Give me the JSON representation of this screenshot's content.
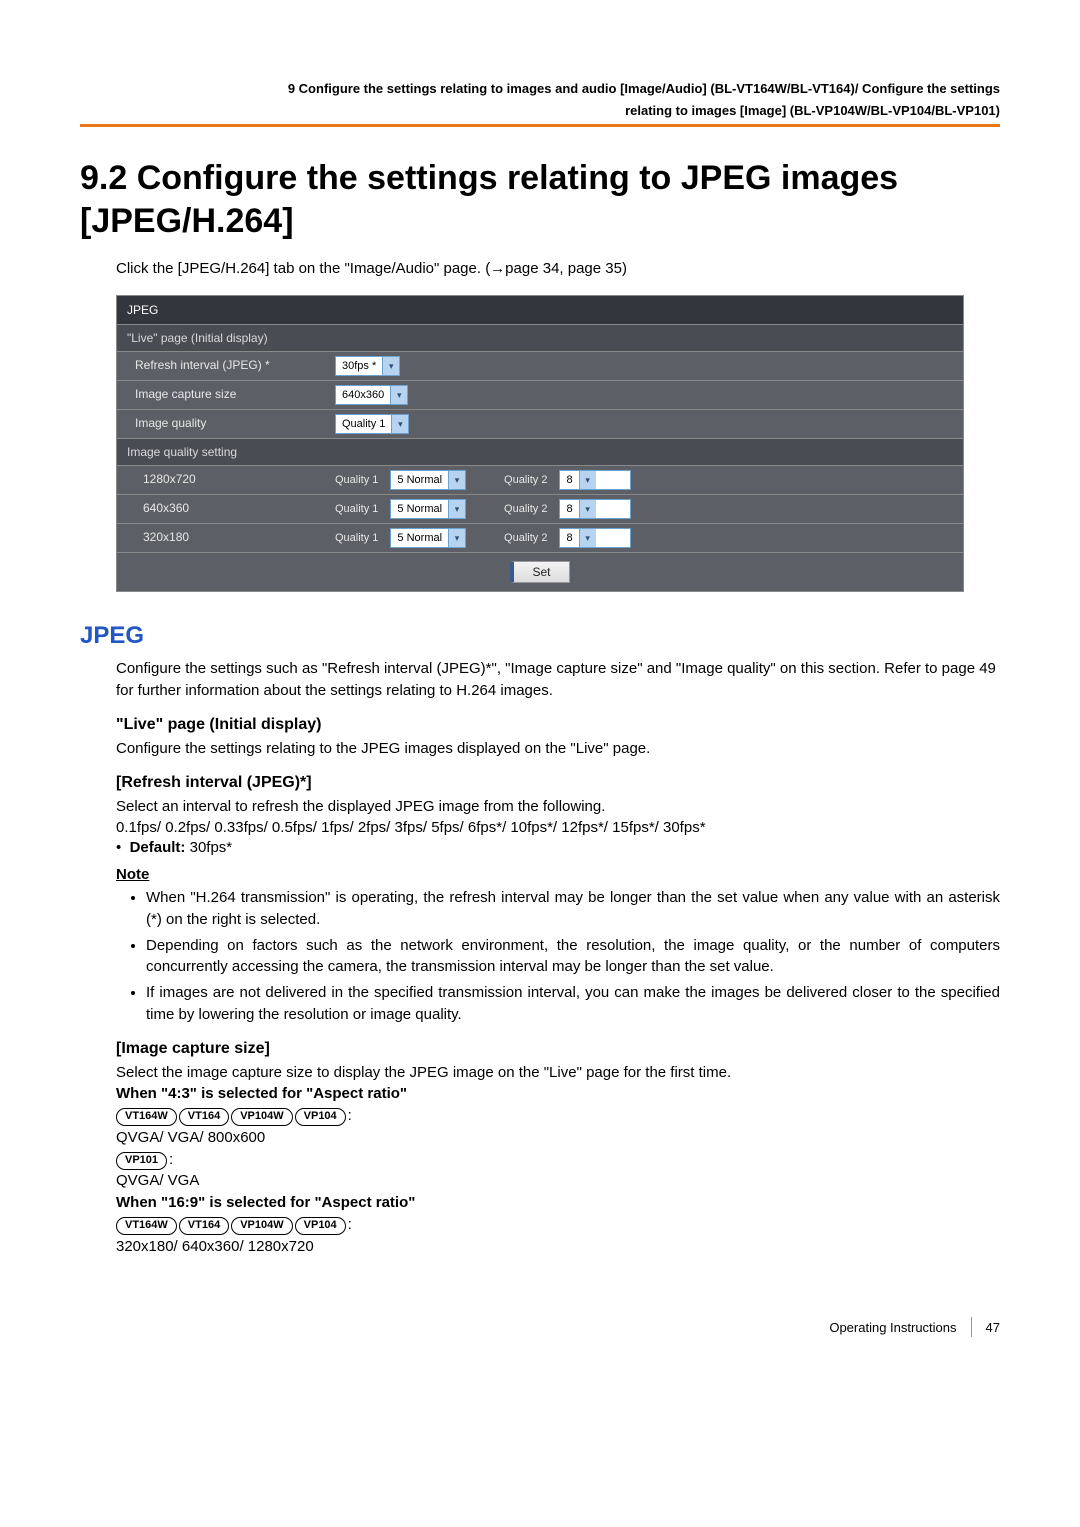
{
  "header": {
    "line1": "9 Configure the settings relating to images and audio [Image/Audio] (BL-VT164W/BL-VT164)/ Configure the settings",
    "line2": "relating to images [Image] (BL-VP104W/BL-VP104/BL-VP101)"
  },
  "title": "9.2  Configure the settings relating to JPEG images [JPEG/H.264]",
  "intro": "Click the [JPEG/H.264] tab on the \"Image/Audio\" page. (→page 34, page 35)",
  "screenshot": {
    "jpeg_header": "JPEG",
    "live_header": "\"Live\" page (Initial display)",
    "rows": {
      "refresh_label": "Refresh interval (JPEG) *",
      "refresh_value": "30fps *",
      "capsize_label": "Image capture size",
      "capsize_value": "640x360",
      "quality_label": "Image quality",
      "quality_value": "Quality 1"
    },
    "quality_setting_header": "Image quality setting",
    "quality_rows": [
      {
        "res": "1280x720",
        "q1": "5 Normal",
        "q2": "8"
      },
      {
        "res": "640x360",
        "q1": "5 Normal",
        "q2": "8"
      },
      {
        "res": "320x180",
        "q1": "5 Normal",
        "q2": "8"
      }
    ],
    "q1_label": "Quality 1",
    "q2_label": "Quality 2",
    "set_button": "Set"
  },
  "section_jpeg_heading": "JPEG",
  "jpeg_intro": "Configure the settings such as \"Refresh interval (JPEG)*\", \"Image capture size\" and \"Image quality\" on this section. Refer to page 49 for further information about the settings relating to H.264 images.",
  "live_heading": "\"Live\" page (Initial display)",
  "live_text": "Configure the settings relating to the JPEG images displayed on the \"Live\" page.",
  "refresh_heading": "[Refresh interval (JPEG)*]",
  "refresh_text1": "Select an interval to refresh the displayed JPEG image from the following.",
  "refresh_text2": "0.1fps/ 0.2fps/ 0.33fps/ 0.5fps/ 1fps/ 2fps/ 3fps/ 5fps/ 6fps*/ 10fps*/ 12fps*/ 15fps*/ 30fps*",
  "default_label": "Default:",
  "default_value": " 30fps*",
  "note_label": "Note",
  "notes": [
    "When \"H.264 transmission\" is operating, the refresh interval may be longer than the set value when any value with an asterisk (*) on the right is selected.",
    "Depending on factors such as the network environment, the resolution, the image quality, or the number of computers concurrently accessing the camera, the transmission interval may be longer than the set value.",
    "If images are not delivered in the specified transmission interval, you can make the images be delivered closer to the specified time by lowering the resolution or image quality."
  ],
  "capsize_heading": "[Image capture size]",
  "capsize_text": "Select the image capture size to display the JPEG image on the \"Live\" page for the first time.",
  "when43": "When \"4:3\" is selected for \"Aspect ratio\"",
  "models_line1": [
    "VT164W",
    "VT164",
    "VP104W",
    "VP104"
  ],
  "models_line1_suffix": ":",
  "res43a": "QVGA/ VGA/ 800x600",
  "models_line2": [
    "VP101"
  ],
  "models_line2_suffix": ":",
  "res43b": "QVGA/ VGA",
  "when169": "When \"16:9\" is selected for \"Aspect ratio\"",
  "models_line3": [
    "VT164W",
    "VT164",
    "VP104W",
    "VP104"
  ],
  "models_line3_suffix": ":",
  "res169": "320x180/ 640x360/ 1280x720",
  "footer": {
    "label": "Operating Instructions",
    "page": "47"
  }
}
